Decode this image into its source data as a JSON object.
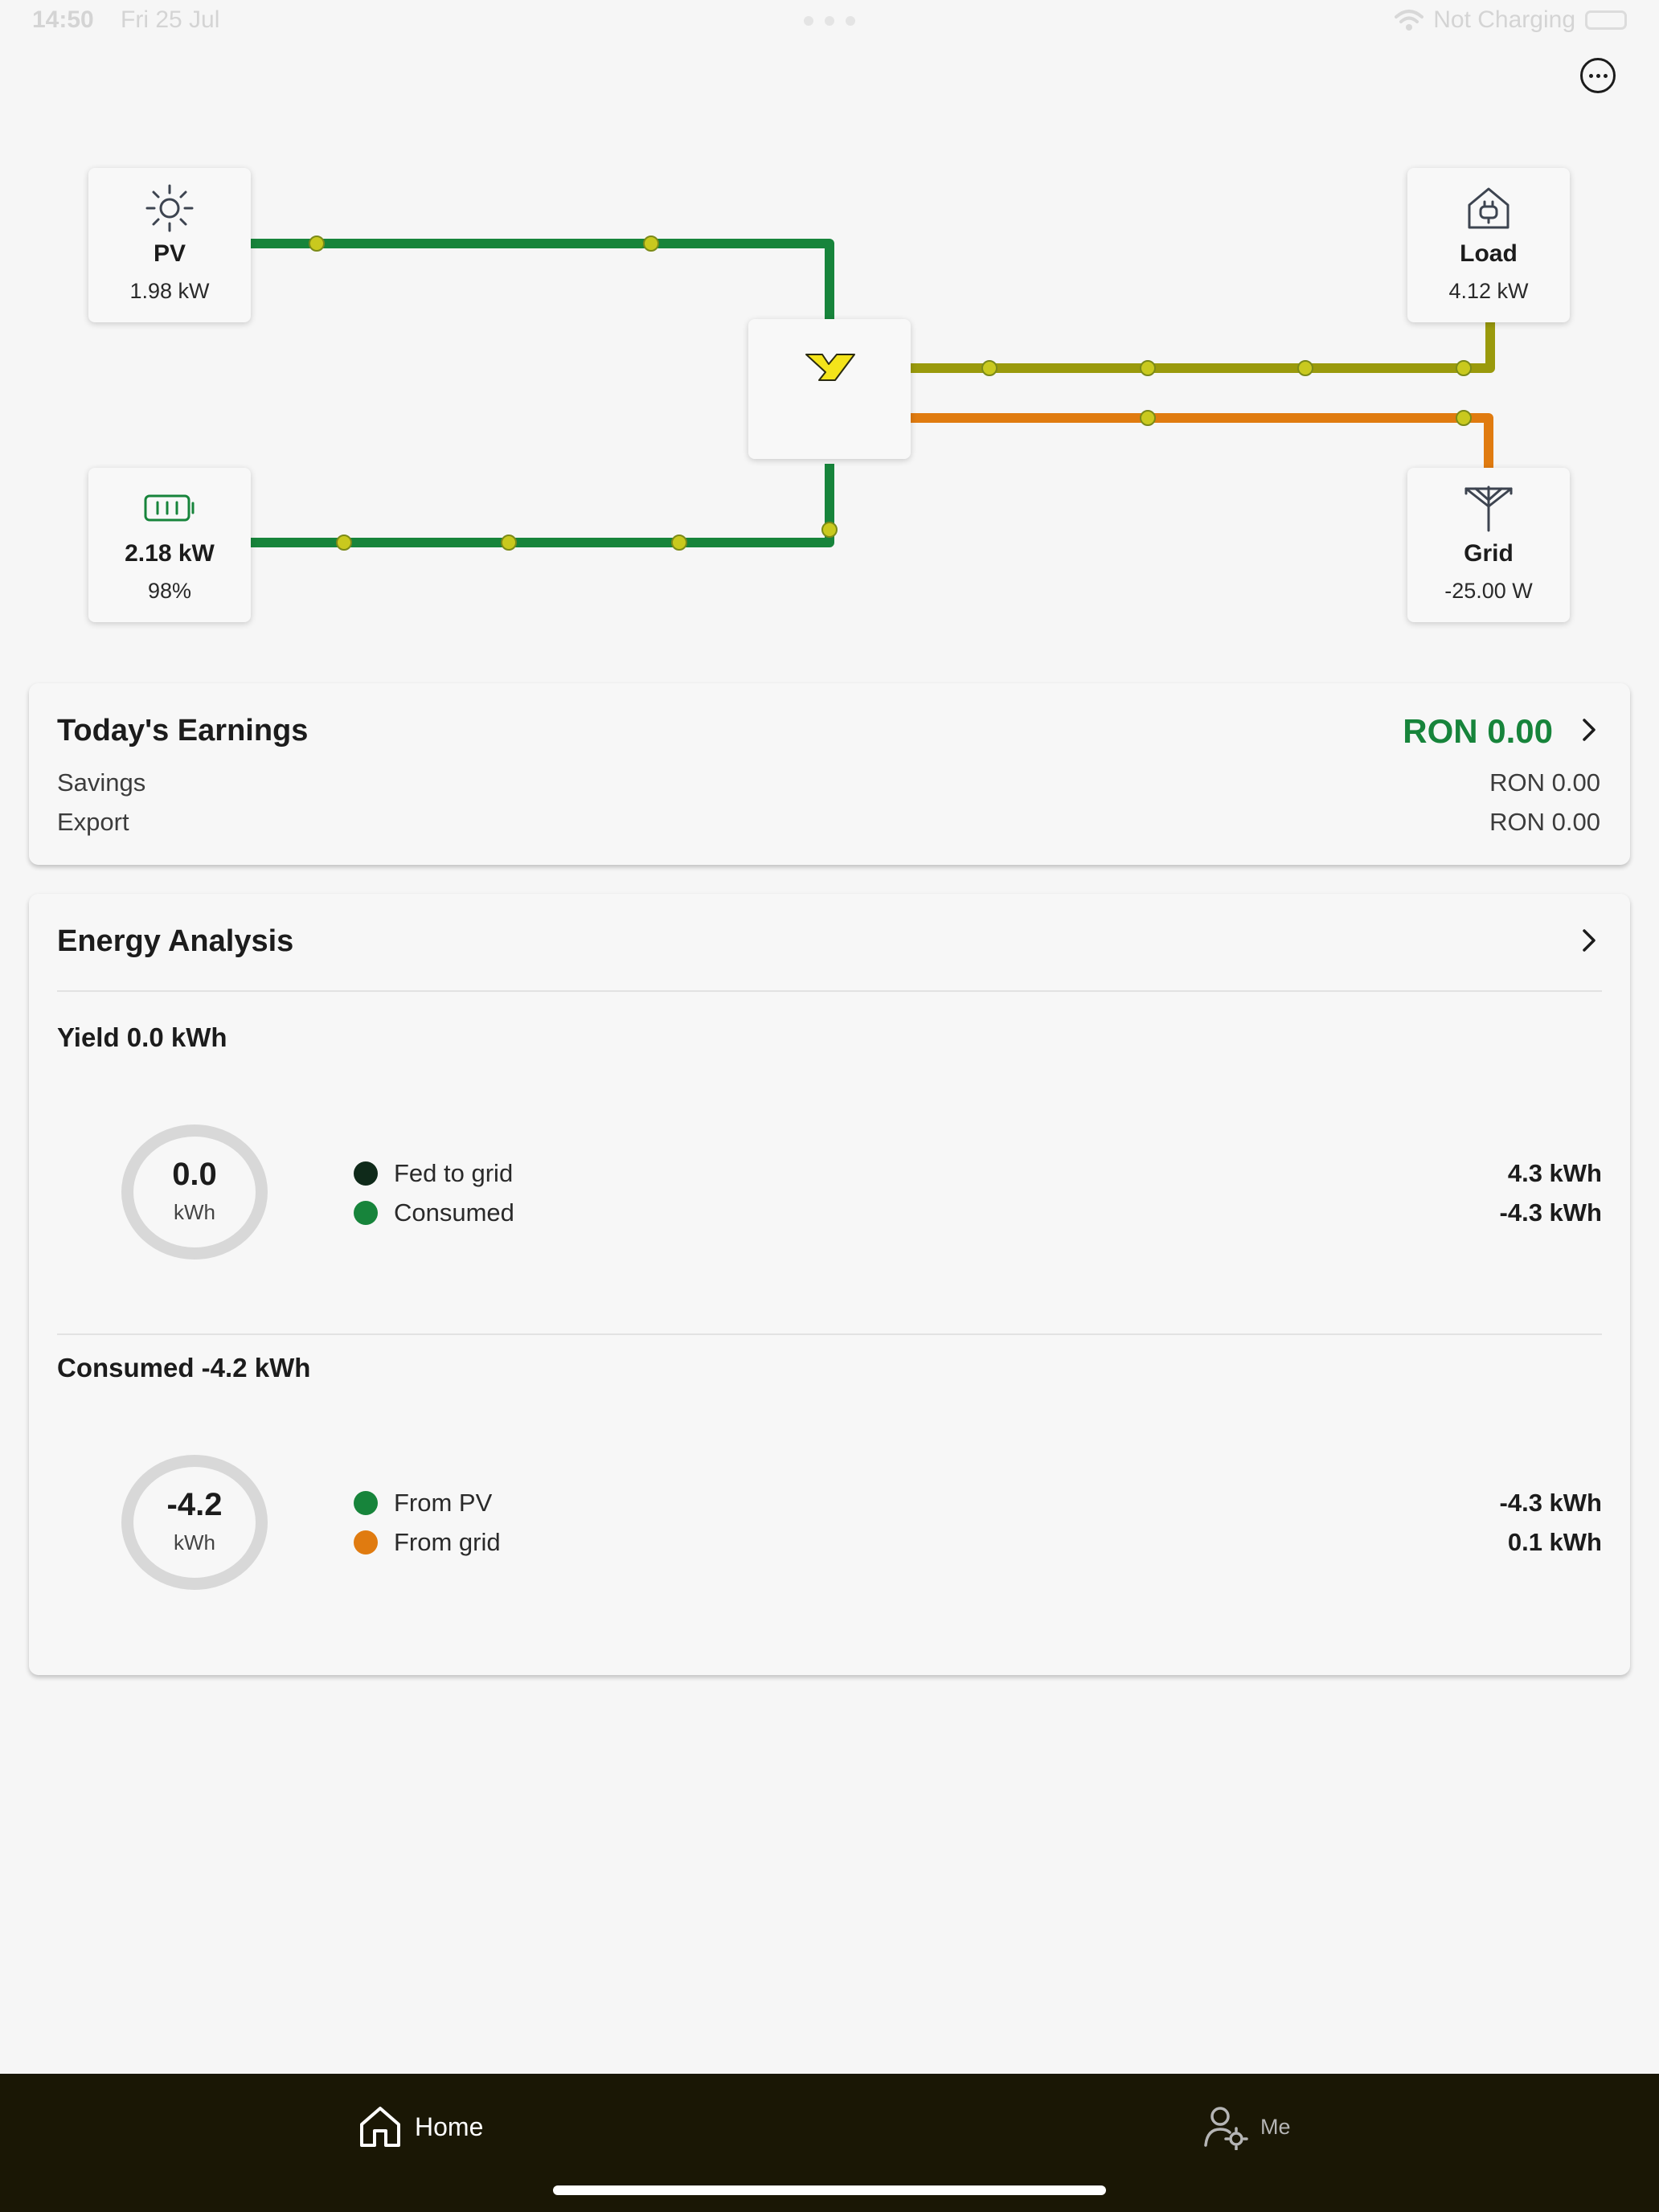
{
  "status_bar": {
    "time": "14:50",
    "date": "Fri 25 Jul",
    "charging": "Not Charging"
  },
  "flow": {
    "pv": {
      "title": "PV",
      "value": "1.98 kW",
      "icon": "sun-icon"
    },
    "load": {
      "title": "Load",
      "value": "4.12 kW",
      "icon": "house-plug-icon"
    },
    "battery": {
      "title": "2.18 kW",
      "value": "98%",
      "icon": "battery-icon"
    },
    "grid": {
      "title": "Grid",
      "value": "-25.00 W",
      "icon": "pylon-icon"
    },
    "inverter": {
      "icon": "brand-logo-icon"
    },
    "colors": {
      "green": "#17843b",
      "olive": "#9a9a0c",
      "orange": "#e07b10",
      "dot": "#c9c91e"
    }
  },
  "earnings": {
    "title": "Today's Earnings",
    "total": "RON 0.00",
    "rows": [
      {
        "label": "Savings",
        "value": "RON 0.00"
      },
      {
        "label": "Export",
        "value": "RON 0.00"
      }
    ]
  },
  "analysis": {
    "title": "Energy Analysis",
    "yield": {
      "title": "Yield 0.0 kWh",
      "ring_value": "0.0",
      "ring_unit": "kWh",
      "legend": [
        {
          "label": "Fed to grid",
          "value": "4.3 kWh",
          "color": "#0f2a1a"
        },
        {
          "label": "Consumed",
          "value": "-4.3 kWh",
          "color": "#17843b"
        }
      ]
    },
    "consumed": {
      "title": "Consumed -4.2 kWh",
      "ring_value": "-4.2",
      "ring_unit": "kWh",
      "legend": [
        {
          "label": "From PV",
          "value": "-4.3 kWh",
          "color": "#17843b"
        },
        {
          "label": "From grid",
          "value": "0.1 kWh",
          "color": "#e07b10"
        }
      ]
    }
  },
  "nav": {
    "home": "Home",
    "me": "Me"
  }
}
